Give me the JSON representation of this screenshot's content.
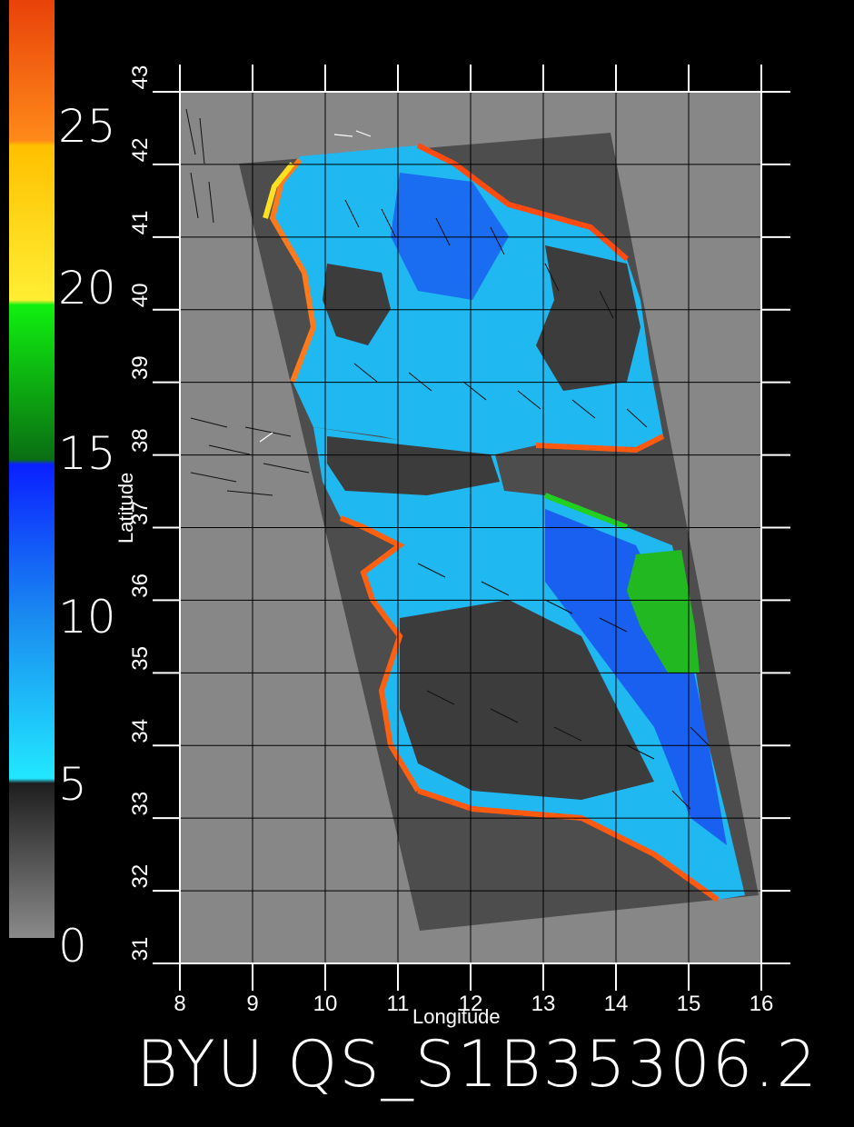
{
  "title": "BYU QS_S1B35306.2",
  "colorbar": {
    "ticks": [
      "25",
      "20",
      "15",
      "10",
      "5",
      "0"
    ],
    "colors": {
      "top_red": "#e8420a",
      "orange": "#ff8a1a",
      "yellow": "#ffee33",
      "green": "#16d60a",
      "dark_green": "#0a6e12",
      "blue": "#0a3cff",
      "cyan": "#21e8ff",
      "dark_gray": "#2a2a2a",
      "light_gray": "#8a8a8a"
    }
  },
  "axes": {
    "xlabel": "Longitude",
    "ylabel": "Latitude",
    "lon_ticks": [
      "8",
      "9",
      "10",
      "11",
      "12",
      "13",
      "14",
      "15",
      "16"
    ],
    "lat_ticks": [
      "31",
      "32",
      "33",
      "34",
      "35",
      "36",
      "37",
      "38",
      "39",
      "40",
      "41",
      "42",
      "43"
    ],
    "lon_range": [
      8,
      16
    ],
    "lat_range": [
      31,
      43
    ]
  },
  "map": {
    "background_color": "#878787",
    "swath_color": "#4d4d4d",
    "grid_color": "#000000"
  }
}
